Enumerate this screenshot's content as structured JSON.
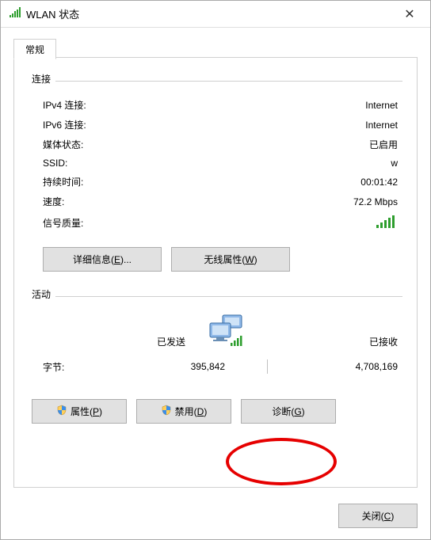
{
  "titlebar": {
    "title": "WLAN 状态"
  },
  "tab": {
    "general": "常规"
  },
  "groups": {
    "connection": "连接",
    "activity": "活动"
  },
  "conn": {
    "ipv4_label": "IPv4 连接:",
    "ipv4_value": "Internet",
    "ipv6_label": "IPv6 连接:",
    "ipv6_value": "Internet",
    "media_label": "媒体状态:",
    "media_value": "已启用",
    "ssid_label": "SSID:",
    "ssid_value": "w",
    "duration_label": "持续时间:",
    "duration_value": "00:01:42",
    "speed_label": "速度:",
    "speed_value": "72.2 Mbps",
    "signal_label": "信号质量:"
  },
  "buttons": {
    "details": "详细信息(E)...",
    "wireless_props": "无线属性(W)",
    "properties": "属性(P)",
    "disable": "禁用(D)",
    "diagnose": "诊断(G)",
    "close": "关闭(C)"
  },
  "activity": {
    "sent_label": "已发送",
    "recv_label": "已接收",
    "bytes_label": "字节:",
    "bytes_sent": "395,842",
    "bytes_recv": "4,708,169"
  },
  "icons": {
    "wifi": "wifi-signal-icon",
    "shield": "uac-shield-icon",
    "computers": "network-computers-icon"
  }
}
